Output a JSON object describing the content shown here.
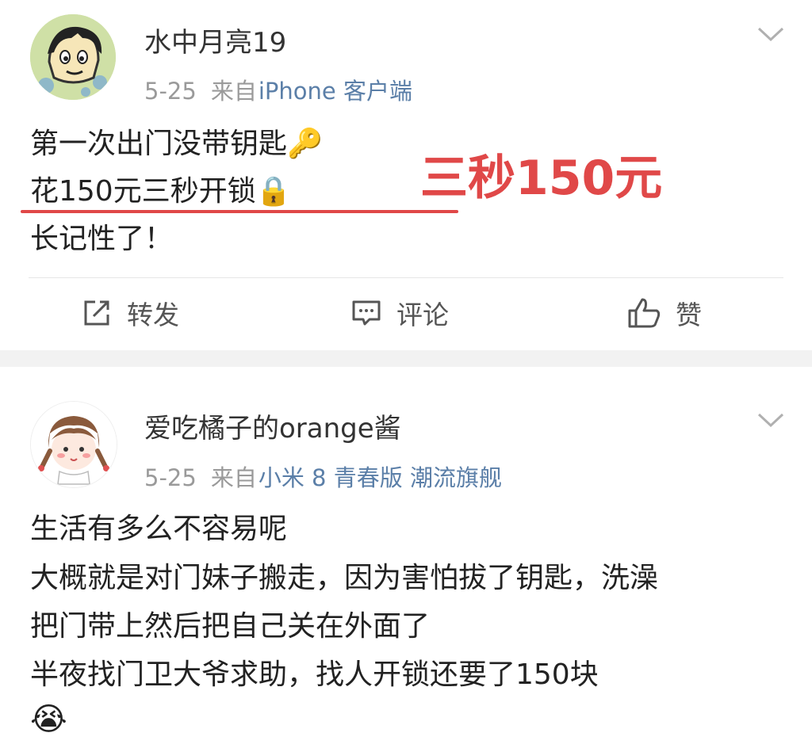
{
  "post1": {
    "username": "水中月亮19",
    "date": "5-25",
    "source_prefix": "来自",
    "source_device": "iPhone 客户端",
    "lines": [
      "第一次出门没带钥匙🔑",
      "花150元三秒开锁🔒",
      "长记性了！"
    ],
    "annotation": "三秒150元",
    "annotation_color": "#e04848",
    "actions": {
      "repost": "转发",
      "comment": "评论",
      "like": "赞"
    }
  },
  "post2": {
    "username": "爱吃橘子的orange酱",
    "date": "5-25",
    "source_prefix": "来自",
    "source_device": "小米 8 青春版 潮流旗舰",
    "lines": [
      "生活有多么不容易呢",
      "大概就是对门妹子搬走，因为害怕拔了钥匙，洗澡",
      "把门带上然后把自己关在外面了",
      "半夜找门卫大爷求助，找人开锁还要了150块",
      "😭"
    ]
  }
}
